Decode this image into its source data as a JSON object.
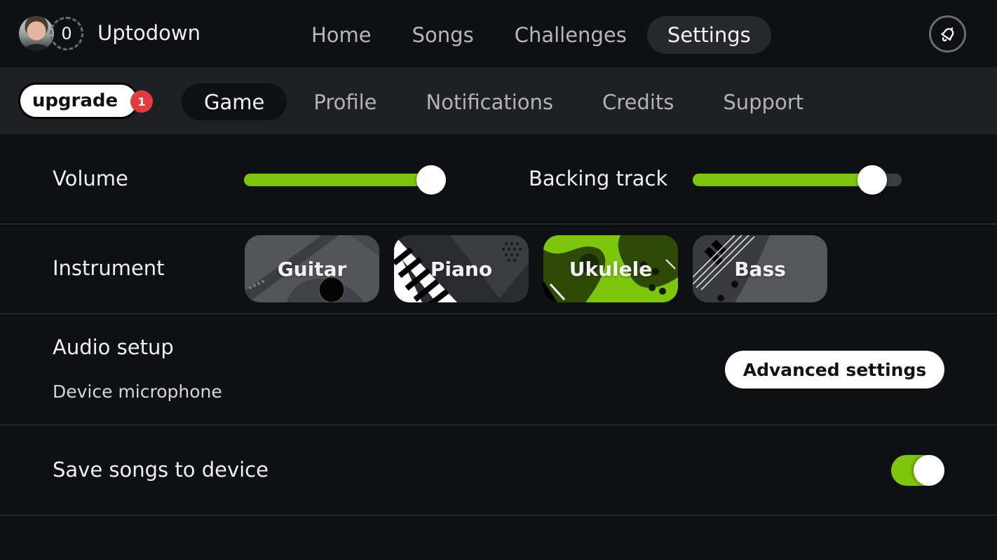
{
  "header": {
    "user": {
      "name": "Uptodown",
      "level": "0",
      "avatar_icon": "user-avatar"
    },
    "nav": [
      {
        "label": "Home",
        "active": false
      },
      {
        "label": "Songs",
        "active": false
      },
      {
        "label": "Challenges",
        "active": false
      },
      {
        "label": "Settings",
        "active": true
      }
    ],
    "notifications_icon": "bell-icon"
  },
  "subnav": {
    "upgrade": {
      "label": "upgrade",
      "badge": "1"
    },
    "tabs": [
      {
        "label": "Game",
        "active": true
      },
      {
        "label": "Profile",
        "active": false
      },
      {
        "label": "Notifications",
        "active": false
      },
      {
        "label": "Credits",
        "active": false
      },
      {
        "label": "Support",
        "active": false
      }
    ]
  },
  "settings": {
    "volume": {
      "label": "Volume",
      "value_percent": 100
    },
    "backing_track": {
      "label": "Backing track",
      "value_percent": 86
    },
    "instrument": {
      "label": "Instrument",
      "options": [
        {
          "label": "Guitar",
          "selected": false
        },
        {
          "label": "Piano",
          "selected": false
        },
        {
          "label": "Ukulele",
          "selected": true
        },
        {
          "label": "Bass",
          "selected": false
        }
      ]
    },
    "audio_setup": {
      "label": "Audio setup",
      "device": "Device microphone",
      "button_label": "Advanced settings"
    },
    "save_songs": {
      "label": "Save songs to device",
      "enabled": true
    }
  },
  "colors": {
    "accent_green": "#7dc60b",
    "badge_red": "#e23b40",
    "background": "#0f1014",
    "subbar": "#1f2024"
  }
}
